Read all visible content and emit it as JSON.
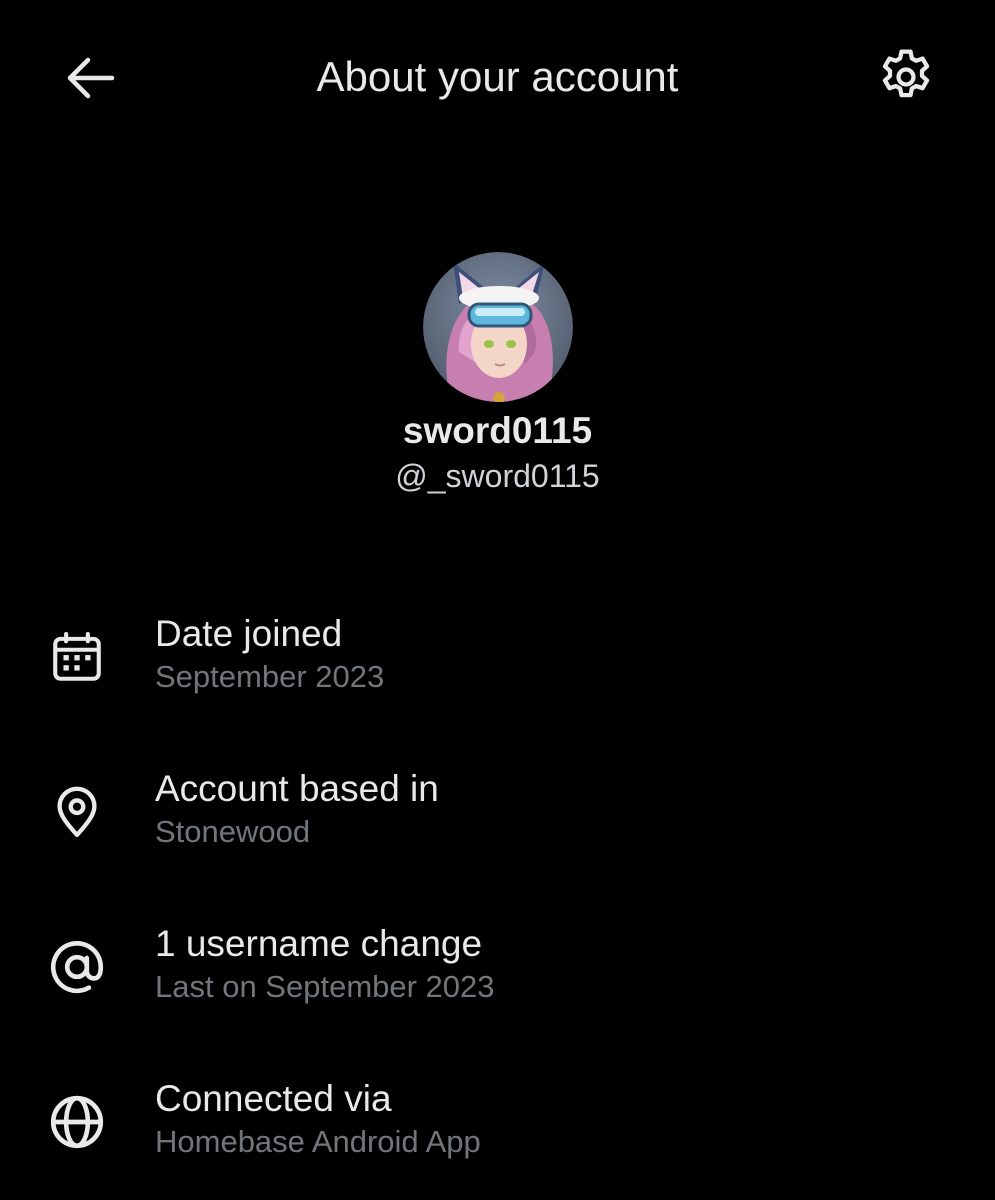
{
  "header": {
    "title": "About your account",
    "back_icon": "arrow-left-icon",
    "settings_icon": "gear-icon"
  },
  "profile": {
    "display_name": "sword0115",
    "handle": "@_sword0115",
    "avatar_icon": "avatar-image"
  },
  "info": [
    {
      "icon": "calendar-icon",
      "title": "Date joined",
      "subtitle": "September 2023"
    },
    {
      "icon": "location-pin-icon",
      "title": "Account based in",
      "subtitle": "Stonewood"
    },
    {
      "icon": "at-sign-icon",
      "title": "1 username change",
      "subtitle": "Last on September 2023"
    },
    {
      "icon": "globe-icon",
      "title": "Connected via",
      "subtitle": "Homebase Android App"
    }
  ],
  "colors": {
    "background": "#000000",
    "primary_text": "#e7e9ea",
    "secondary_text": "#71767b"
  }
}
